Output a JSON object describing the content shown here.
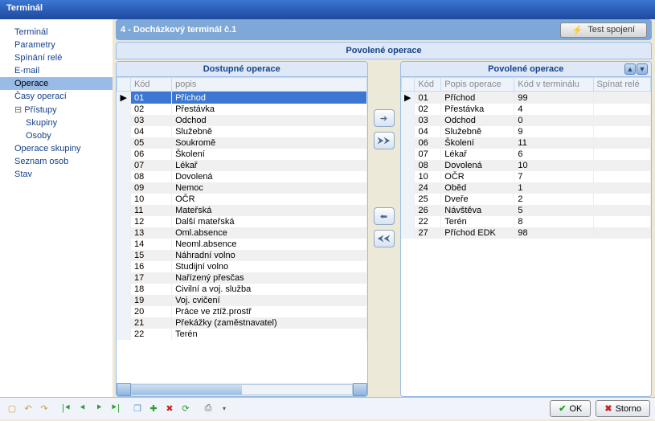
{
  "window": {
    "title": "Terminál"
  },
  "sidebar": {
    "items": [
      {
        "label": "Terminál",
        "selected": false
      },
      {
        "label": "Parametry",
        "selected": false
      },
      {
        "label": "Spínání relé",
        "selected": false
      },
      {
        "label": "E-mail",
        "selected": false
      },
      {
        "label": "Operace",
        "selected": true
      },
      {
        "label": "Časy operací",
        "selected": false
      },
      {
        "label": "Přístupy",
        "selected": false,
        "expandable": true,
        "children": [
          {
            "label": "Skupiny"
          },
          {
            "label": "Osoby"
          }
        ]
      },
      {
        "label": "Operace skupiny",
        "selected": false
      },
      {
        "label": "Seznam osob",
        "selected": false
      },
      {
        "label": "Stav",
        "selected": false
      }
    ]
  },
  "header": {
    "title": "4   -   Docházkový terminál č.1",
    "test_connection": "Test spojení"
  },
  "section_title": "Povolené operace",
  "available": {
    "title": "Dostupné operace",
    "columns": [
      "Kód",
      "popis"
    ],
    "rows": [
      {
        "code": "01",
        "desc": "Příchod",
        "selected": true
      },
      {
        "code": "02",
        "desc": "Přestávka"
      },
      {
        "code": "03",
        "desc": "Odchod"
      },
      {
        "code": "04",
        "desc": "Služebně"
      },
      {
        "code": "05",
        "desc": "Soukromě"
      },
      {
        "code": "06",
        "desc": "Školení"
      },
      {
        "code": "07",
        "desc": "Lékař"
      },
      {
        "code": "08",
        "desc": "Dovolená"
      },
      {
        "code": "09",
        "desc": "Nemoc"
      },
      {
        "code": "10",
        "desc": "OČR"
      },
      {
        "code": "11",
        "desc": "Mateřská"
      },
      {
        "code": "12",
        "desc": "Další mateřská"
      },
      {
        "code": "13",
        "desc": "Oml.absence"
      },
      {
        "code": "14",
        "desc": "Neoml.absence"
      },
      {
        "code": "15",
        "desc": "Náhradní volno"
      },
      {
        "code": "16",
        "desc": "Studijní volno"
      },
      {
        "code": "17",
        "desc": "Nařízený přesčas"
      },
      {
        "code": "18",
        "desc": "Civilní a voj. služba"
      },
      {
        "code": "19",
        "desc": "Voj. cvičení"
      },
      {
        "code": "20",
        "desc": "Práce ve ztíž.prostř"
      },
      {
        "code": "21",
        "desc": "Překážky (zaměstnavatel)"
      },
      {
        "code": "22",
        "desc": "Terén"
      }
    ]
  },
  "allowed": {
    "title": "Povolené operace",
    "columns": [
      "Kód",
      "Popis operace",
      "Kód v terminálu",
      "Spínat relé"
    ],
    "rows": [
      {
        "code": "01",
        "desc": "Příchod",
        "term": "99",
        "relay": "",
        "selected": true
      },
      {
        "code": "02",
        "desc": "Přestávka",
        "term": "4",
        "relay": ""
      },
      {
        "code": "03",
        "desc": "Odchod",
        "term": "0",
        "relay": ""
      },
      {
        "code": "04",
        "desc": "Služebně",
        "term": "9",
        "relay": ""
      },
      {
        "code": "06",
        "desc": "Školení",
        "term": "11",
        "relay": ""
      },
      {
        "code": "07",
        "desc": "Lékař",
        "term": "6",
        "relay": ""
      },
      {
        "code": "08",
        "desc": "Dovolená",
        "term": "10",
        "relay": ""
      },
      {
        "code": "10",
        "desc": "OČR",
        "term": "7",
        "relay": ""
      },
      {
        "code": "24",
        "desc": "Oběd",
        "term": "1",
        "relay": ""
      },
      {
        "code": "25",
        "desc": "Dveře",
        "term": "2",
        "relay": ""
      },
      {
        "code": "26",
        "desc": "Návštěva",
        "term": "5",
        "relay": ""
      },
      {
        "code": "22",
        "desc": "Terén",
        "term": "8",
        "relay": ""
      },
      {
        "code": "27",
        "desc": "Příchod EDK",
        "term": "98",
        "relay": ""
      }
    ]
  },
  "footer": {
    "ok": "OK",
    "storno": "Storno"
  },
  "colors": {
    "accent": "#3b77d3",
    "panel": "#dfe8f6",
    "border": "#99bbe8"
  }
}
